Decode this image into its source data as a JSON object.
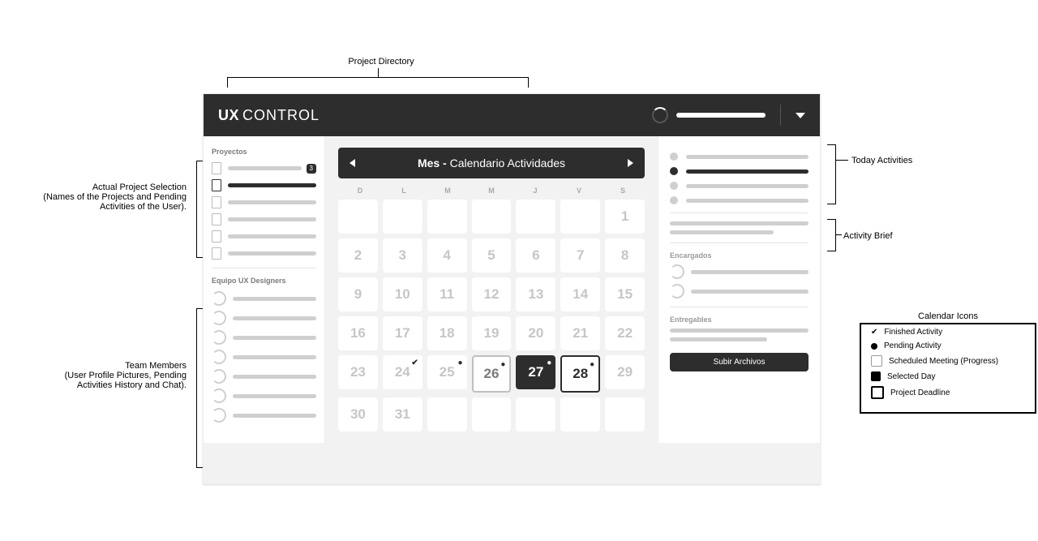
{
  "header": {
    "logo_bold": "UX",
    "logo_light": "CONTROL"
  },
  "sidebar": {
    "projects_heading": "Proyectos",
    "team_heading": "Equipo UX Designers",
    "project_badge": "3"
  },
  "calendar": {
    "title_bold": "Mes -",
    "title_rest": " Calendario Actividades",
    "dow": [
      "D",
      "L",
      "M",
      "M",
      "J",
      "V",
      "S"
    ],
    "days": [
      {
        "n": ""
      },
      {
        "n": ""
      },
      {
        "n": ""
      },
      {
        "n": ""
      },
      {
        "n": ""
      },
      {
        "n": ""
      },
      {
        "n": "1"
      },
      {
        "n": "2"
      },
      {
        "n": "3"
      },
      {
        "n": "4"
      },
      {
        "n": "5"
      },
      {
        "n": "6"
      },
      {
        "n": "7"
      },
      {
        "n": "8"
      },
      {
        "n": "9"
      },
      {
        "n": "10"
      },
      {
        "n": "11"
      },
      {
        "n": "12"
      },
      {
        "n": "13"
      },
      {
        "n": "14"
      },
      {
        "n": "15"
      },
      {
        "n": "16"
      },
      {
        "n": "17"
      },
      {
        "n": "18"
      },
      {
        "n": "19"
      },
      {
        "n": "20"
      },
      {
        "n": "21"
      },
      {
        "n": "22"
      },
      {
        "n": "23"
      },
      {
        "n": "24",
        "mark": "✔"
      },
      {
        "n": "25",
        "mark": "●"
      },
      {
        "n": "26",
        "mark": "●",
        "cls": "meet"
      },
      {
        "n": "27",
        "mark": "●",
        "cls": "today"
      },
      {
        "n": "28",
        "mark": "●",
        "cls": "deadline"
      },
      {
        "n": "29"
      },
      {
        "n": "30"
      },
      {
        "n": "31"
      },
      {
        "n": ""
      },
      {
        "n": ""
      },
      {
        "n": ""
      },
      {
        "n": ""
      },
      {
        "n": ""
      }
    ]
  },
  "right": {
    "encargados_heading": "Encargados",
    "entregables_heading": "Entregables",
    "upload_label": "Subir Archivos"
  },
  "annotations": {
    "project_directory": "Project Directory",
    "project_sel_title": "Actual Project Selection",
    "project_sel_desc": "(Names of the Projects and Pending Activities of the User).",
    "team_title": "Team Members",
    "team_desc": "(User Profile Pictures, Pending Activities History and Chat).",
    "today_activities": "Today Activities",
    "activity_brief": "Activity Brief",
    "legend_title": "Calendar Icons",
    "legend_items": [
      "Finished Activity",
      "Pending Activity",
      "Scheduled Meeting (Progress)",
      "Selected Day",
      "Project Deadline"
    ]
  }
}
